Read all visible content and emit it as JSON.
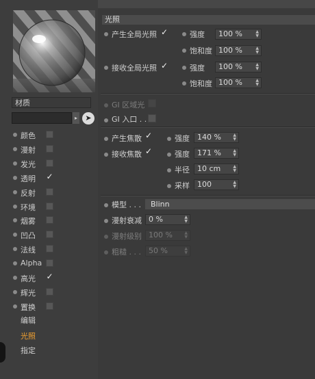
{
  "section": {
    "title": "光照"
  },
  "material_name": "材质",
  "channels": [
    {
      "label": "颜色",
      "checked": false
    },
    {
      "label": "漫射",
      "checked": false
    },
    {
      "label": "发光",
      "checked": false
    },
    {
      "label": "透明",
      "checked": true
    },
    {
      "label": "反射",
      "checked": false
    },
    {
      "label": "环境",
      "checked": false
    },
    {
      "label": "烟雾",
      "checked": false
    },
    {
      "label": "凹凸",
      "checked": false
    },
    {
      "label": "法线",
      "checked": false
    },
    {
      "label": "Alpha",
      "checked": false
    },
    {
      "label": "高光",
      "checked": true
    },
    {
      "label": "辉光",
      "checked": false
    },
    {
      "label": "置换",
      "checked": false
    }
  ],
  "tabs": [
    {
      "label": "编辑",
      "active": false
    },
    {
      "label": "光照",
      "active": true
    },
    {
      "label": "指定",
      "active": false
    }
  ],
  "gi": {
    "generate_label": "产生全局光照",
    "generate_checked": true,
    "generate_strength_label": "强度",
    "generate_strength": "100 %",
    "generate_saturation_label": "饱和度",
    "generate_saturation": "100 %",
    "receive_label": "接收全局光照",
    "receive_checked": true,
    "receive_strength_label": "强度",
    "receive_strength": "100 %",
    "receive_saturation_label": "饱和度",
    "receive_saturation": "100 %"
  },
  "gi_area": {
    "label": "GI 区域光",
    "enabled": false
  },
  "gi_portal": {
    "label": "GI 入口 . ."
  },
  "caustics": {
    "generate_label": "产生焦散",
    "generate_checked": true,
    "generate_strength_label": "强度",
    "generate_strength": "140 %",
    "receive_label": "接收焦散",
    "receive_checked": true,
    "receive_strength_label": "强度",
    "receive_strength": "171 %",
    "radius_label": "半径",
    "radius": "10 cm",
    "samples_label": "采样",
    "samples": "100"
  },
  "illumination": {
    "model_label": "模型 . . .",
    "model_value": "Blinn",
    "diffuse_falloff_label": "漫射衰减",
    "diffuse_falloff": "0 %",
    "diffuse_level_label": "漫射级别",
    "diffuse_level": "100 %",
    "roughness_label": "粗糙 . . .",
    "roughness": "50 %"
  },
  "colors": {
    "accent_tab": "#f0a030",
    "checkmark": "#f0f0f0"
  }
}
